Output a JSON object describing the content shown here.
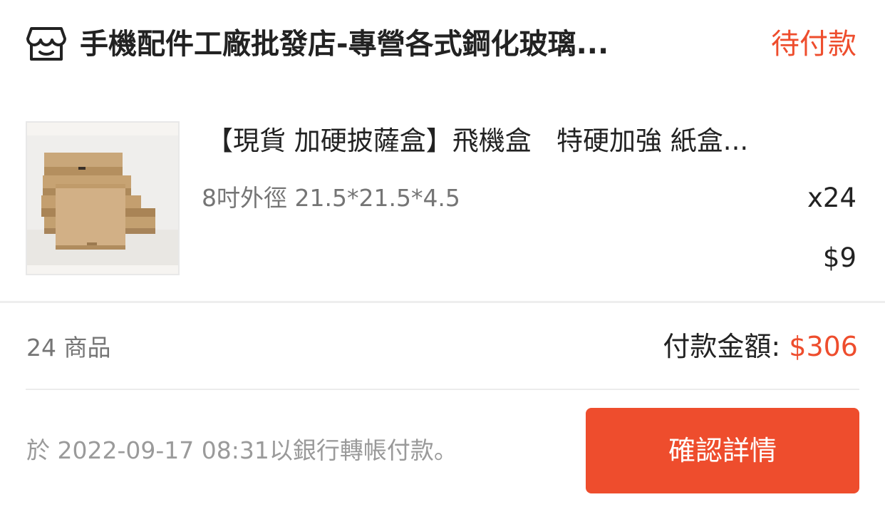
{
  "shop": {
    "icon": "shop-icon",
    "name": "手機配件工廠批發店-專營各式鋼化玻璃...",
    "status": "待付款"
  },
  "product": {
    "image": "pizza-box-product-image",
    "title": "【現貨 加硬披薩盒】飛機盒   特硬加強 紙盒...",
    "variant": "8吋外徑 21.5*21.5*4.5",
    "quantity": "x24",
    "price": "$9"
  },
  "summary": {
    "item_count": "24 商品",
    "total_label": "付款金額: ",
    "total_amount": "$306"
  },
  "footer": {
    "payment_note": "於 2022-09-17 08:31以銀行轉帳付款。",
    "confirm_label": "確認詳情"
  },
  "colors": {
    "accent": "#ee4d2d",
    "text_primary": "#222222",
    "text_secondary": "#757575",
    "text_muted": "#9a9a9a",
    "divider": "#eeeeee"
  }
}
